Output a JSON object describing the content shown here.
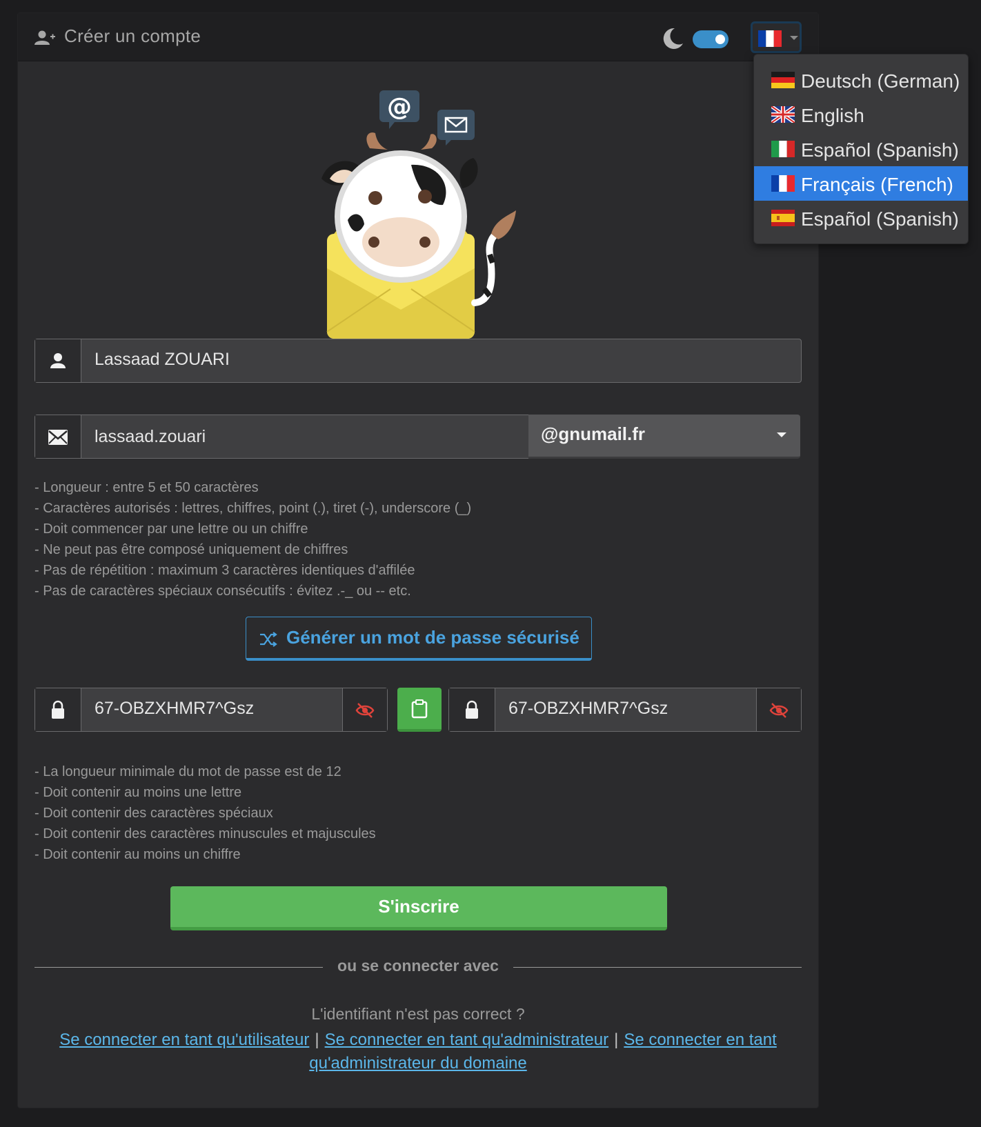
{
  "header": {
    "title": "Créer un compte",
    "title_icon": "add-user-icon",
    "theme_icon": "moon-icon",
    "dark_mode_enabled": true,
    "language_flag": "fr"
  },
  "language_menu": {
    "items": [
      {
        "label": "Deutsch (German)",
        "flag": "de",
        "active": false
      },
      {
        "label": "English",
        "flag": "gb",
        "active": false
      },
      {
        "label": "Español (Spanish)",
        "flag": "it",
        "active": false
      },
      {
        "label": "Français (French)",
        "flag": "fr",
        "active": true
      },
      {
        "label": "Español (Spanish)",
        "flag": "es",
        "active": false
      }
    ]
  },
  "form": {
    "name_value": "Lassaad ZOUARI",
    "email_value": "lassaad.zouari",
    "domain_value": "@gnumail.fr",
    "email_rules": [
      "- Longueur : entre 5 et 50 caractères",
      "- Caractères autorisés : lettres, chiffres, point (.), tiret (-), underscore (_)",
      "- Doit commencer par une lettre ou un chiffre",
      "- Ne peut pas être composé uniquement de chiffres",
      "- Pas de répétition : maximum 3 caractères identiques d'affilée",
      "- Pas de caractères spéciaux consécutifs : évitez .-_ ou -- etc."
    ],
    "generate_label": "Générer un mot de passe sécurisé",
    "password_value": "67-OBZXHMR7^Gsz",
    "password_confirm_value": "67-OBZXHMR7^Gsz",
    "password_rules": [
      "- La longueur minimale du mot de passe est de 12",
      "- Doit contenir au moins une lettre",
      "- Doit contenir des caractères spéciaux",
      "- Doit contenir des caractères minuscules et majuscules",
      "- Doit contenir au moins un chiffre"
    ],
    "submit_label": "S'inscrire"
  },
  "footer": {
    "divider_text": "ou se connecter avec",
    "question": "L'identifiant n'est pas correct ?",
    "link_user": "Se connecter en tant qu'utilisateur",
    "link_admin": "Se connecter en tant qu'administrateur",
    "link_domain_admin": "Se connecter en tant qu'administrateur du domaine",
    "separator": "|"
  },
  "colors": {
    "accent_blue": "#3a8fc9",
    "success_green": "#5cb85c",
    "link": "#5bb7ea",
    "active_menu": "#2f7de1"
  }
}
